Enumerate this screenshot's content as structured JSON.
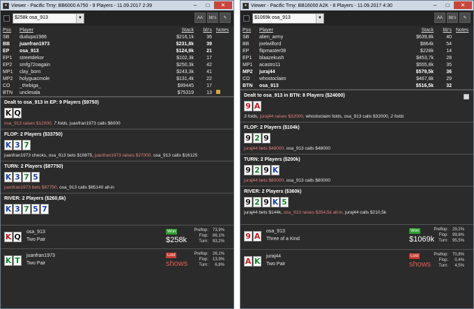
{
  "left": {
    "title": "Viewer - Pacific Trny: BB6000 A750 - 9 Players - 11.09.2017 2:39",
    "selector": "$258k osa_913",
    "toolbar_buttons": [
      "AA",
      "bb's",
      "edit"
    ],
    "headers": {
      "pos": "Pos",
      "player": "Player",
      "stack": "Stack",
      "bbs": "bb's",
      "notes": "Notes"
    },
    "players": [
      {
        "pos": "SB",
        "name": "dudupa1986",
        "stack": "$216,1k",
        "bbs": "36",
        "hero": false
      },
      {
        "pos": "BB",
        "name": "juanfran1973",
        "stack": "$231,8k",
        "bbs": "39",
        "hero": true
      },
      {
        "pos": "EP",
        "name": "osa_913",
        "stack": "$124,9k",
        "bbs": "21",
        "hero": true
      },
      {
        "pos": "EP1",
        "name": "streetdekor",
        "stack": "$102,3k",
        "bbs": "17",
        "hero": false
      },
      {
        "pos": "EP2",
        "name": "smfg72oagain",
        "stack": "$250,3k",
        "bbs": "42",
        "hero": false
      },
      {
        "pos": "MP1",
        "name": "clay_born",
        "stack": "$243,3k",
        "bbs": "41",
        "hero": false
      },
      {
        "pos": "MP2",
        "name": "holyguacmole",
        "stack": "$131,4k",
        "bbs": "22",
        "hero": false
      },
      {
        "pos": "CO",
        "name": "_thebiga_",
        "stack": "$99445",
        "bbs": "17",
        "hero": false
      },
      {
        "pos": "BTN",
        "name": "unclesala",
        "stack": "$75319",
        "bbs": "13",
        "hero": false
      }
    ],
    "preflop": {
      "header": "Dealt to osa_913 in EP: 9 Players ($9750)",
      "cards": [
        {
          "r": "K",
          "s": "s"
        },
        {
          "r": "Q",
          "s": "s"
        }
      ],
      "action_raise": "osa_913 raises $12000,",
      "action_rest": " 7 folds,",
      "action_tail": " juanfran1973 calls $6000"
    },
    "flop": {
      "header": "FLOP: 2 Players ($33750)",
      "cards": [
        {
          "r": "K",
          "s": "d"
        },
        {
          "r": "3",
          "s": "d"
        },
        {
          "r": "7",
          "s": "c"
        }
      ],
      "a1": "juanfran1973 checks, osa_913 bets $10875,",
      "a2": " juanfran1973 raises $27000,",
      "a3": " osa_913 calls $16125"
    },
    "turn": {
      "header": "TURN: 2 Players ($87750)",
      "cards": [
        {
          "r": "K",
          "s": "d"
        },
        {
          "r": "3",
          "s": "d"
        },
        {
          "r": "7",
          "s": "c"
        },
        {
          "r": "5",
          "s": "d"
        }
      ],
      "a1": "juanfran1973 bets $87750,",
      "a2": " osa_913 calls $85140 all-in"
    },
    "river": {
      "header": "RIVER: 2 Players ($260,6k)",
      "cards": [
        {
          "r": "K",
          "s": "d"
        },
        {
          "r": "3",
          "s": "d"
        },
        {
          "r": "7",
          "s": "c"
        },
        {
          "r": "5",
          "s": "d"
        },
        {
          "r": "7",
          "s": "d"
        }
      ]
    },
    "results": [
      {
        "cards": [
          {
            "r": "K",
            "s": "h"
          },
          {
            "r": "Q",
            "s": "s"
          }
        ],
        "name": "osa_913",
        "hand": "Two Pair",
        "badge": "Won",
        "amount": "$258k",
        "stats": [
          [
            "Preflop:",
            "73,9%"
          ],
          [
            "Flop:",
            "86,1%"
          ],
          [
            "Turn:",
            "93,2%"
          ]
        ]
      },
      {
        "cards": [
          {
            "r": "K",
            "s": "c"
          },
          {
            "r": "T",
            "s": "c"
          }
        ],
        "name": "juanfran1973",
        "hand": "Two Pair",
        "badge": "Lost",
        "amount": "shows",
        "stats": [
          [
            "Preflop:",
            "26,1%"
          ],
          [
            "Flop:",
            "13,9%"
          ],
          [
            "Turn:",
            "6,8%"
          ]
        ]
      }
    ]
  },
  "right": {
    "title": "Viewer - Pacific Trny: BB16000 A2K - 8 Players - 11.09.2017 4:30",
    "selector": "$1069k osa_913",
    "toolbar_buttons": [
      "AA",
      "bb's",
      "edit"
    ],
    "headers": {
      "pos": "Pos",
      "player": "Player",
      "stack": "Stack",
      "bbs": "bb's",
      "notes": "Notes"
    },
    "players": [
      {
        "pos": "SB",
        "name": "alien_army",
        "stack": "$639,8k",
        "bbs": "40",
        "hero": false
      },
      {
        "pos": "BB",
        "name": "joelwilford",
        "stack": "$864k",
        "bbs": "54",
        "hero": false
      },
      {
        "pos": "EP",
        "name": "flipmaster08",
        "stack": "$228k",
        "bbs": "14",
        "hero": false
      },
      {
        "pos": "EP1",
        "name": "blaazekush",
        "stack": "$453,7k",
        "bbs": "28",
        "hero": false
      },
      {
        "pos": "MP1",
        "name": "acastro11",
        "stack": "$555,8k",
        "bbs": "35",
        "hero": false
      },
      {
        "pos": "MP2",
        "name": "juraj44",
        "stack": "$579,5k",
        "bbs": "36",
        "hero": true
      },
      {
        "pos": "CO",
        "name": "whostoclaim",
        "stack": "$467,8k",
        "bbs": "29",
        "hero": false
      },
      {
        "pos": "BTN",
        "name": "osa_913",
        "stack": "$516,5k",
        "bbs": "32",
        "hero": true
      }
    ],
    "preflop": {
      "header": "Dealt to osa_913 in BTN: 8 Players ($24000)",
      "cards": [
        {
          "r": "9",
          "s": "h"
        },
        {
          "r": "A",
          "s": "h"
        }
      ],
      "action_pre": "3 folds,",
      "action_raise": " juraj44 raises $32000,",
      "action_rest": " whostoclaim folds, osa_913 calls $32000,",
      "action_tail": " 2 folds"
    },
    "flop": {
      "header": "FLOP: 2 Players ($104k)",
      "cards": [
        {
          "r": "9",
          "s": "s"
        },
        {
          "r": "2",
          "s": "c"
        },
        {
          "r": "9",
          "s": "s"
        }
      ],
      "a1": "juraj44 bets $48000,",
      "a2": " osa_913 calls $48000"
    },
    "turn": {
      "header": "TURN: 2 Players ($200k)",
      "cards": [
        {
          "r": "9",
          "s": "s"
        },
        {
          "r": "2",
          "s": "c"
        },
        {
          "r": "9",
          "s": "s"
        },
        {
          "r": "K",
          "s": "d"
        }
      ],
      "a1": "juraj44 bets $80000,",
      "a2": " osa_913 calls $80000"
    },
    "river": {
      "header": "RIVER: 2 Players ($360k)",
      "cards": [
        {
          "r": "9",
          "s": "s"
        },
        {
          "r": "2",
          "s": "c"
        },
        {
          "r": "9",
          "s": "s"
        },
        {
          "r": "K",
          "s": "d"
        },
        {
          "r": "5",
          "s": "c"
        }
      ],
      "a1": "juraj44 bets $144k,",
      "a2": " osa_913 raises $354,5k all-in,",
      "a3": " juraj44 calls $210,5k"
    },
    "results": [
      {
        "cards": [
          {
            "r": "9",
            "s": "h"
          },
          {
            "r": "A",
            "s": "h"
          }
        ],
        "name": "osa_913",
        "hand": "Three of a Kind",
        "badge": "Won",
        "amount": "$1069k",
        "stats": [
          [
            "Preflop:",
            "29,2%"
          ],
          [
            "Flop:",
            "99,6%"
          ],
          [
            "Turn:",
            "95,5%"
          ]
        ]
      },
      {
        "cards": [
          {
            "r": "A",
            "s": "h"
          },
          {
            "r": "K",
            "s": "c"
          }
        ],
        "name": "juraj44",
        "hand": "Two Pair",
        "badge": "Lost",
        "amount": "shows",
        "stats": [
          [
            "Preflop:",
            "70,8%"
          ],
          [
            "Flop:",
            "0,4%"
          ],
          [
            "Turn:",
            "4,5%"
          ]
        ]
      }
    ]
  }
}
